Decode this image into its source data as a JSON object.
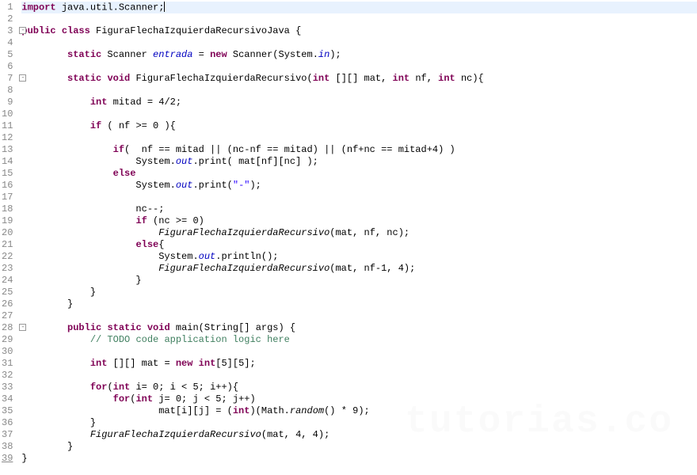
{
  "lines": [
    {
      "n": 1,
      "hl": true,
      "cursor": true,
      "tokens": [
        {
          "c": "kw",
          "t": "import"
        },
        {
          "t": " java.util.Scanner;"
        }
      ]
    },
    {
      "n": 2,
      "tokens": []
    },
    {
      "n": 3,
      "fold": true,
      "tokens": [
        {
          "c": "kw",
          "t": "public"
        },
        {
          "t": " "
        },
        {
          "c": "kw",
          "t": "class"
        },
        {
          "t": " FiguraFlechaIzquierdaRecursivoJava {"
        }
      ]
    },
    {
      "n": 4,
      "tokens": []
    },
    {
      "n": 5,
      "tokens": [
        {
          "t": "        "
        },
        {
          "c": "kw",
          "t": "static"
        },
        {
          "t": " Scanner "
        },
        {
          "c": "it",
          "t": "entrada"
        },
        {
          "t": " = "
        },
        {
          "c": "kw",
          "t": "new"
        },
        {
          "t": " Scanner(System."
        },
        {
          "c": "it",
          "t": "in"
        },
        {
          "t": ");"
        }
      ]
    },
    {
      "n": 6,
      "tokens": []
    },
    {
      "n": 7,
      "fold": true,
      "tokens": [
        {
          "t": "        "
        },
        {
          "c": "kw",
          "t": "static"
        },
        {
          "t": " "
        },
        {
          "c": "kw",
          "t": "void"
        },
        {
          "t": " FiguraFlechaIzquierdaRecursivo("
        },
        {
          "c": "kw",
          "t": "int"
        },
        {
          "t": " [][] mat, "
        },
        {
          "c": "kw",
          "t": "int"
        },
        {
          "t": " nf, "
        },
        {
          "c": "kw",
          "t": "int"
        },
        {
          "t": " nc){"
        }
      ]
    },
    {
      "n": 8,
      "tokens": []
    },
    {
      "n": 9,
      "tokens": [
        {
          "t": "            "
        },
        {
          "c": "kw",
          "t": "int"
        },
        {
          "t": " mitad = 4/2;"
        }
      ]
    },
    {
      "n": 10,
      "tokens": []
    },
    {
      "n": 11,
      "tokens": [
        {
          "t": "            "
        },
        {
          "c": "kw",
          "t": "if"
        },
        {
          "t": " ( nf >= 0 ){"
        }
      ]
    },
    {
      "n": 12,
      "tokens": []
    },
    {
      "n": 13,
      "tokens": [
        {
          "t": "                "
        },
        {
          "c": "kw",
          "t": "if"
        },
        {
          "t": "(  nf == mitad || (nc-nf == mitad) || (nf+nc == mitad+4) )"
        }
      ]
    },
    {
      "n": 14,
      "tokens": [
        {
          "t": "                    System."
        },
        {
          "c": "it",
          "t": "out"
        },
        {
          "t": ".print( mat[nf][nc] );"
        }
      ]
    },
    {
      "n": 15,
      "tokens": [
        {
          "t": "                "
        },
        {
          "c": "kw",
          "t": "else"
        }
      ]
    },
    {
      "n": 16,
      "tokens": [
        {
          "t": "                    System."
        },
        {
          "c": "it",
          "t": "out"
        },
        {
          "t": ".print("
        },
        {
          "c": "str",
          "t": "\"-\""
        },
        {
          "t": ");"
        }
      ]
    },
    {
      "n": 17,
      "tokens": []
    },
    {
      "n": 18,
      "tokens": [
        {
          "t": "                    nc--;"
        }
      ]
    },
    {
      "n": 19,
      "tokens": [
        {
          "t": "                    "
        },
        {
          "c": "kw",
          "t": "if"
        },
        {
          "t": " (nc >= 0)"
        }
      ]
    },
    {
      "n": 20,
      "tokens": [
        {
          "t": "                        "
        },
        {
          "c": "itb",
          "t": "FiguraFlechaIzquierdaRecursivo"
        },
        {
          "t": "(mat, nf, nc);"
        }
      ]
    },
    {
      "n": 21,
      "tokens": [
        {
          "t": "                    "
        },
        {
          "c": "kw",
          "t": "else"
        },
        {
          "t": "{"
        }
      ]
    },
    {
      "n": 22,
      "tokens": [
        {
          "t": "                        System."
        },
        {
          "c": "it",
          "t": "out"
        },
        {
          "t": ".println();"
        }
      ]
    },
    {
      "n": 23,
      "tokens": [
        {
          "t": "                        "
        },
        {
          "c": "itb",
          "t": "FiguraFlechaIzquierdaRecursivo"
        },
        {
          "t": "(mat, nf-1, 4);"
        }
      ]
    },
    {
      "n": 24,
      "tokens": [
        {
          "t": "                    }"
        }
      ]
    },
    {
      "n": 25,
      "tokens": [
        {
          "t": "            }"
        }
      ]
    },
    {
      "n": 26,
      "tokens": [
        {
          "t": "        }"
        }
      ]
    },
    {
      "n": 27,
      "tokens": []
    },
    {
      "n": 28,
      "fold": true,
      "tokens": [
        {
          "t": "        "
        },
        {
          "c": "kw",
          "t": "public"
        },
        {
          "t": " "
        },
        {
          "c": "kw",
          "t": "static"
        },
        {
          "t": " "
        },
        {
          "c": "kw",
          "t": "void"
        },
        {
          "t": " main(String[] args) {"
        }
      ]
    },
    {
      "n": 29,
      "tokens": [
        {
          "t": "            "
        },
        {
          "c": "com",
          "t": "// TODO code application logic here"
        }
      ]
    },
    {
      "n": 30,
      "tokens": []
    },
    {
      "n": 31,
      "tokens": [
        {
          "t": "            "
        },
        {
          "c": "kw",
          "t": "int"
        },
        {
          "t": " [][] mat = "
        },
        {
          "c": "kw",
          "t": "new"
        },
        {
          "t": " "
        },
        {
          "c": "kw",
          "t": "int"
        },
        {
          "t": "[5][5];"
        }
      ]
    },
    {
      "n": 32,
      "tokens": []
    },
    {
      "n": 33,
      "tokens": [
        {
          "t": "            "
        },
        {
          "c": "kw",
          "t": "for"
        },
        {
          "t": "("
        },
        {
          "c": "kw",
          "t": "int"
        },
        {
          "t": " i= 0; i < 5; i++){"
        }
      ]
    },
    {
      "n": 34,
      "tokens": [
        {
          "t": "                "
        },
        {
          "c": "kw",
          "t": "for"
        },
        {
          "t": "("
        },
        {
          "c": "kw",
          "t": "int"
        },
        {
          "t": " j= 0; j < 5; j++)"
        }
      ]
    },
    {
      "n": 35,
      "tokens": [
        {
          "t": "                        mat[i][j] = ("
        },
        {
          "c": "kw",
          "t": "int"
        },
        {
          "t": ")(Math."
        },
        {
          "c": "itb",
          "t": "random"
        },
        {
          "t": "() * 9);"
        }
      ]
    },
    {
      "n": 36,
      "tokens": [
        {
          "t": "            }"
        }
      ]
    },
    {
      "n": 37,
      "tokens": [
        {
          "t": "            "
        },
        {
          "c": "itb",
          "t": "FiguraFlechaIzquierdaRecursivo"
        },
        {
          "t": "(mat, 4, 4);"
        }
      ]
    },
    {
      "n": 38,
      "tokens": [
        {
          "t": "        }"
        }
      ]
    },
    {
      "n": 39,
      "u": true,
      "tokens": [
        {
          "t": "}"
        }
      ]
    }
  ],
  "watermark": "tutorias.co"
}
